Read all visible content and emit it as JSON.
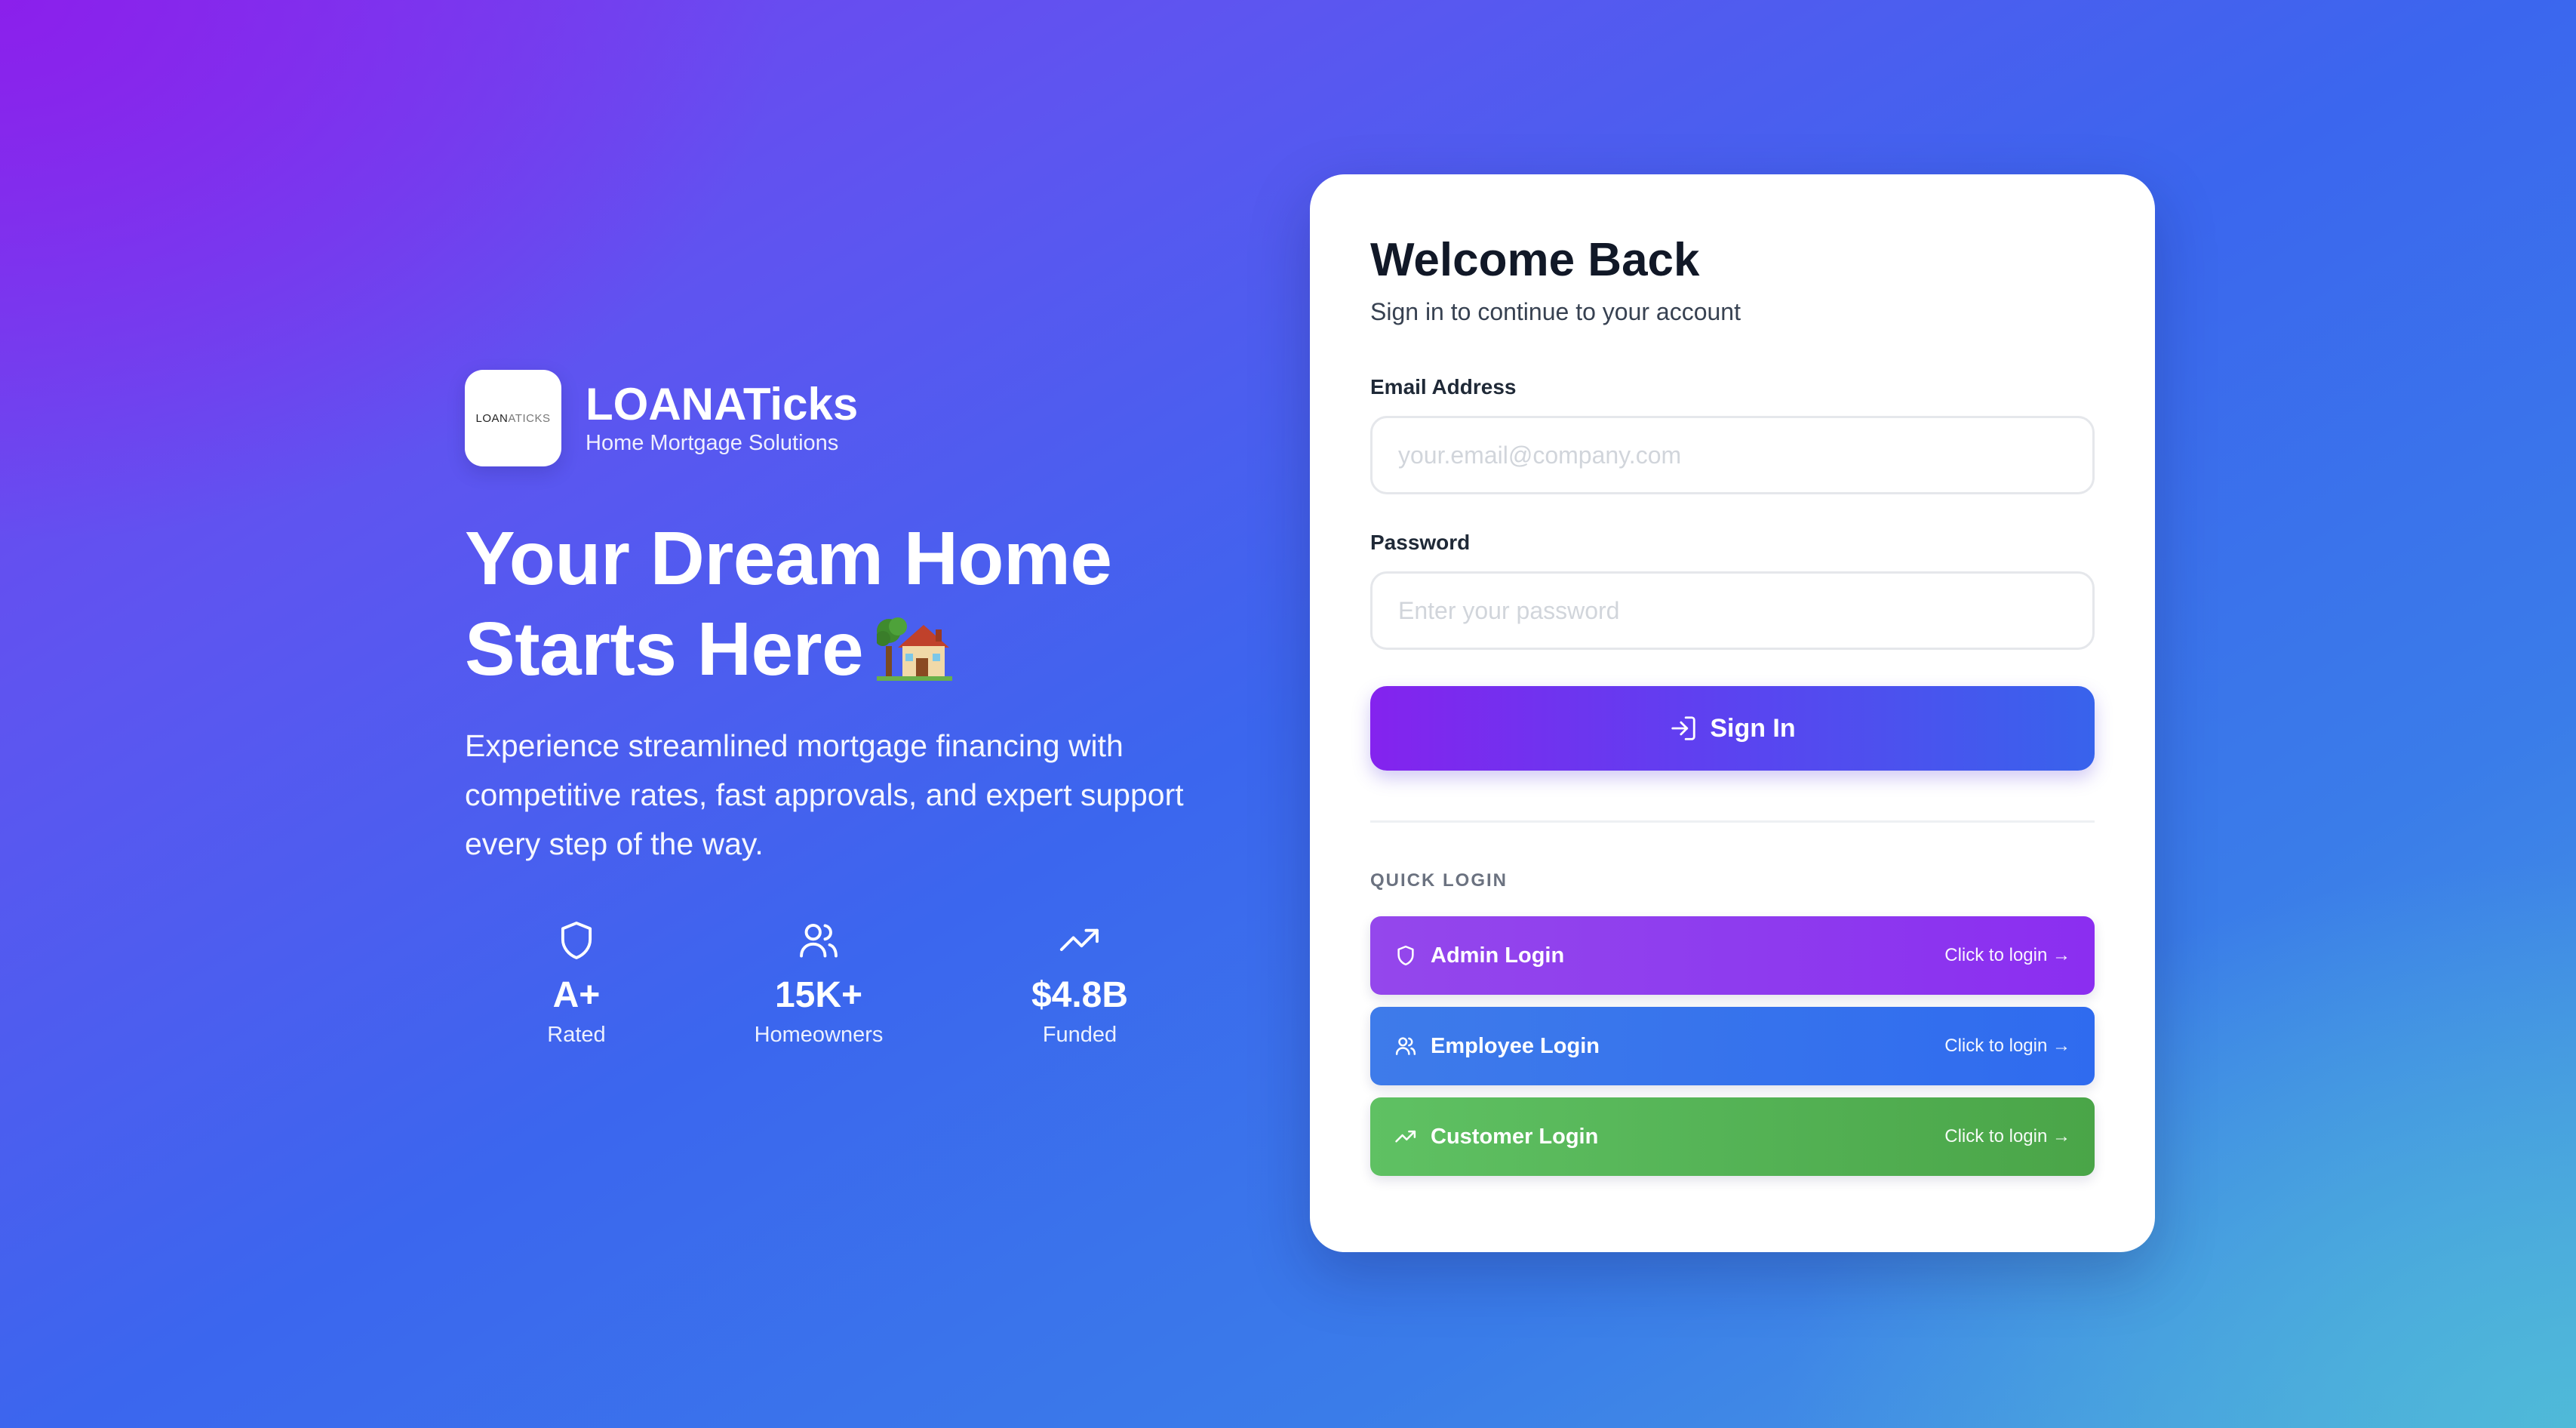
{
  "brand": {
    "logo_text_bold": "LOAN",
    "logo_text_light": "ATICKS",
    "name": "LOANATicks",
    "tagline": "Home Mortgage Solutions"
  },
  "hero": {
    "headline_line1": "Your Dream Home",
    "headline_line2": "Starts Here",
    "headline_emoji": "house-with-garden",
    "description": "Experience streamlined mortgage financing with competitive rates, fast approvals, and expert support every step of the way."
  },
  "stats": [
    {
      "icon": "shield-icon",
      "value": "A+",
      "label": "Rated"
    },
    {
      "icon": "users-icon",
      "value": "15K+",
      "label": "Homeowners"
    },
    {
      "icon": "trending-up-icon",
      "value": "$4.8B",
      "label": "Funded"
    }
  ],
  "login": {
    "title": "Welcome Back",
    "subtitle": "Sign in to continue to your account",
    "email_label": "Email Address",
    "email_placeholder": "your.email@company.com",
    "email_value": "",
    "password_label": "Password",
    "password_placeholder": "Enter your password",
    "password_value": "",
    "signin_label": "Sign In",
    "quick_login_label": "QUICK LOGIN",
    "quick_logins": [
      {
        "name": "Admin Login",
        "cta": "Click to login →",
        "icon": "shield-icon"
      },
      {
        "name": "Employee Login",
        "cta": "Click to login →",
        "icon": "users-icon"
      },
      {
        "name": "Customer Login",
        "cta": "Click to login →",
        "icon": "trending-up-icon"
      }
    ]
  },
  "colors": {
    "accent_purple": "#8423ee",
    "accent_blue": "#3863ec",
    "admin": "#9447ec",
    "employee": "#2f6bef",
    "customer": "#4aa548"
  }
}
